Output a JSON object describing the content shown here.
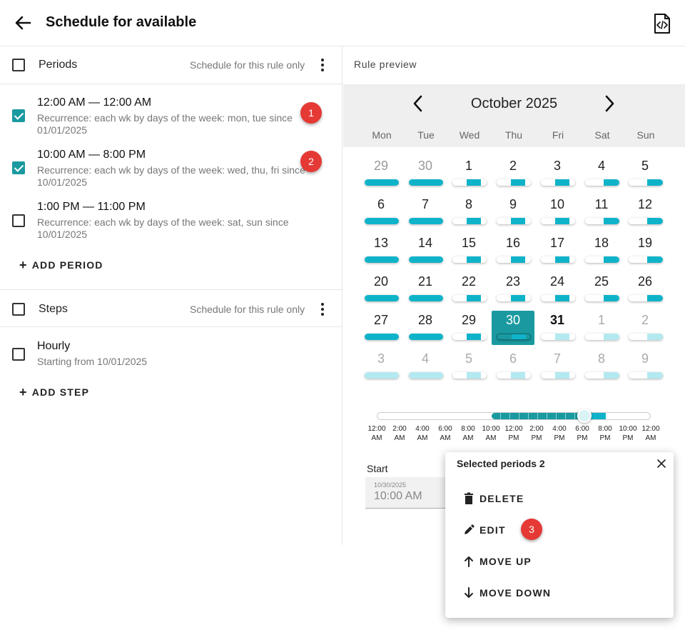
{
  "header": {
    "title": "Schedule for available"
  },
  "periods": {
    "title": "Periods",
    "note": "Schedule for this rule only",
    "items": [
      {
        "time": "12:00 AM — 12:00 AM",
        "recurrence": "Recurrence: each wk by days of the week: mon, tue since",
        "since": "01/01/2025",
        "checked": true,
        "badge": "1"
      },
      {
        "time": "10:00 AM — 8:00 PM",
        "recurrence": "Recurrence: each wk by days of the week: wed, thu, fri since",
        "since": "10/01/2025",
        "checked": true,
        "badge": "2"
      },
      {
        "time": "1:00 PM — 11:00 PM",
        "recurrence": "Recurrence: each wk by days of the week: sat, sun since",
        "since": "10/01/2025",
        "checked": false
      }
    ],
    "add_label": "ADD PERIOD"
  },
  "steps": {
    "title": "Steps",
    "note": "Schedule for this rule only",
    "items": [
      {
        "title": "Hourly",
        "sub": "Starting from 10/01/2025",
        "checked": false
      }
    ],
    "add_label": "ADD STEP"
  },
  "preview": {
    "label": "Rule preview",
    "month": "October 2025",
    "weekdays": [
      "Mon",
      "Tue",
      "Wed",
      "Thu",
      "Fri",
      "Sat",
      "Sun"
    ],
    "weeks": [
      [
        "29",
        "30",
        "1",
        "2",
        "3",
        "4",
        "5"
      ],
      [
        "6",
        "7",
        "8",
        "9",
        "10",
        "11",
        "12"
      ],
      [
        "13",
        "14",
        "15",
        "16",
        "17",
        "18",
        "19"
      ],
      [
        "20",
        "21",
        "22",
        "23",
        "24",
        "25",
        "26"
      ],
      [
        "27",
        "28",
        "29",
        "30",
        "31",
        "1",
        "2"
      ],
      [
        "3",
        "4",
        "5",
        "6",
        "7",
        "8",
        "9"
      ]
    ],
    "today": "30",
    "time_ticks": [
      [
        "12:00",
        "AM"
      ],
      [
        "2:00",
        "AM"
      ],
      [
        "4:00",
        "AM"
      ],
      [
        "6:00",
        "AM"
      ],
      [
        "8:00",
        "AM"
      ],
      [
        "10:00",
        "AM"
      ],
      [
        "12:00",
        "PM"
      ],
      [
        "2:00",
        "PM"
      ],
      [
        "4:00",
        "PM"
      ],
      [
        "6:00",
        "PM"
      ],
      [
        "8:00",
        "PM"
      ],
      [
        "10:00",
        "PM"
      ],
      [
        "12:00",
        "AM"
      ]
    ],
    "start_label": "Start",
    "start_date": "10/30/2025",
    "start_time": "10:00 AM"
  },
  "popup": {
    "title": "Selected periods 2",
    "items": [
      {
        "label": "DELETE",
        "icon": "trash-icon"
      },
      {
        "label": "EDIT",
        "icon": "pencil-icon",
        "badge": "3"
      },
      {
        "label": "MOVE UP",
        "icon": "arrow-up-icon"
      },
      {
        "label": "MOVE DOWN",
        "icon": "arrow-down-icon"
      }
    ]
  },
  "colors": {
    "accent": "#1a9aa0",
    "bar": "#0fb3c9",
    "bar_future": "#b3e9f0",
    "badge": "#e53935"
  }
}
